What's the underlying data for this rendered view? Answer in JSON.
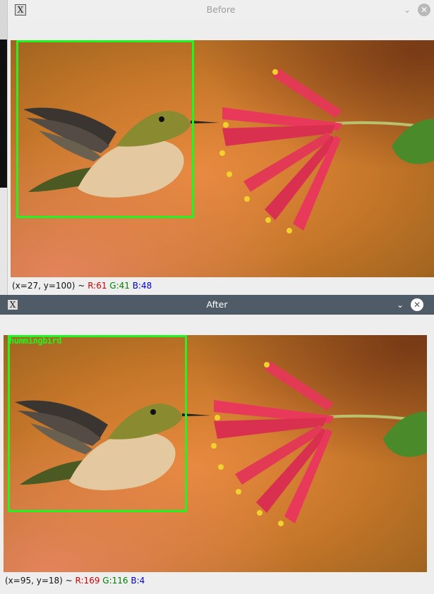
{
  "windows": {
    "before": {
      "title": "Before",
      "detection": {},
      "status": {
        "coords": "(x=27, y=100) ~",
        "r": "R:61",
        "g": "G:41",
        "b": "B:48"
      }
    },
    "after": {
      "title": "After",
      "detection": {
        "label": "hummingbird"
      },
      "status": {
        "coords": "(x=95, y=18) ~",
        "r": "R:169",
        "g": "G:116",
        "b": "B:4"
      }
    }
  },
  "icons": {
    "app": "x-app-icon",
    "minimize": "chevron-down-icon",
    "close": "close-icon"
  },
  "colors": {
    "detection_box": "#1ff51f",
    "after_titlebar": "#4f5b66"
  }
}
